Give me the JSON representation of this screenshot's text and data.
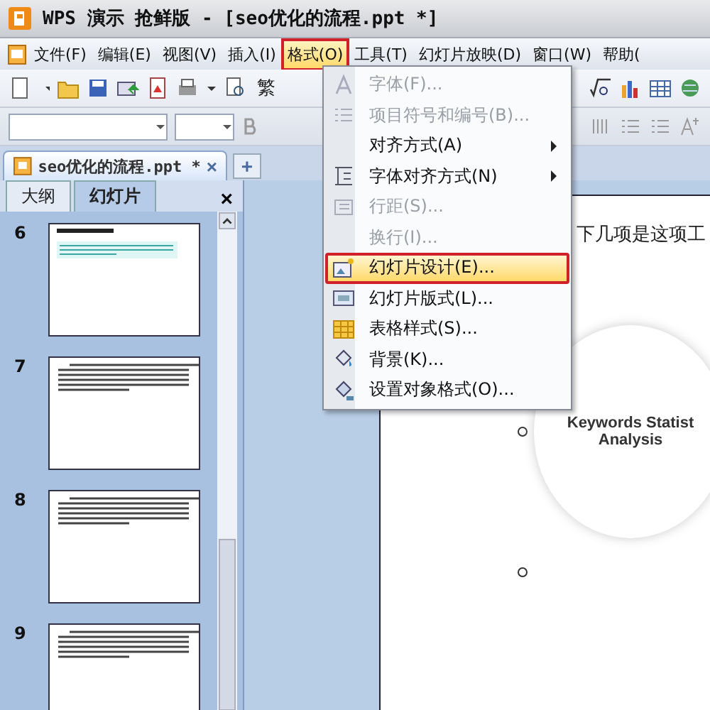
{
  "window": {
    "title": "WPS 演示 抢鲜版 - [seo优化的流程.ppt *]"
  },
  "menu_bar": [
    {
      "label": "文件(F)",
      "selected": false,
      "annotated": false
    },
    {
      "label": "编辑(E)",
      "selected": false,
      "annotated": false
    },
    {
      "label": "视图(V)",
      "selected": false,
      "annotated": false
    },
    {
      "label": "插入(I)",
      "selected": false,
      "annotated": false
    },
    {
      "label": "格式(O)",
      "selected": true,
      "annotated": true
    },
    {
      "label": "工具(T)",
      "selected": false,
      "annotated": false
    },
    {
      "label": "幻灯片放映(D)",
      "selected": false,
      "annotated": false
    },
    {
      "label": "窗口(W)",
      "selected": false,
      "annotated": false
    },
    {
      "label": "帮助(",
      "selected": false,
      "annotated": false
    }
  ],
  "toolbar": {
    "chinese_button": "繁"
  },
  "document_tab": {
    "title": "seo优化的流程.ppt *",
    "close": "×",
    "new_tab": "+"
  },
  "side_panel": {
    "tabs": [
      {
        "label": "大纲",
        "selected": false
      },
      {
        "label": "幻灯片",
        "selected": true
      }
    ],
    "close": "×",
    "slides": [
      {
        "number": "6",
        "kind": "highlight"
      },
      {
        "number": "7",
        "kind": "text"
      },
      {
        "number": "8",
        "kind": "text"
      },
      {
        "number": "9",
        "kind": "text"
      }
    ]
  },
  "slide": {
    "text": "下几项是这项工",
    "circle_title": "Keywords Statist",
    "circle_subtitle": "Analysis"
  },
  "format_menu": [
    {
      "label": "字体(F)...",
      "disabled": true,
      "submenu": false,
      "selected": false,
      "annotated": false
    },
    {
      "label": "项目符号和编号(B)...",
      "disabled": true,
      "submenu": false,
      "selected": false,
      "annotated": false
    },
    {
      "label": "对齐方式(A)",
      "disabled": false,
      "submenu": true,
      "selected": false,
      "annotated": false
    },
    {
      "label": "字体对齐方式(N)",
      "disabled": false,
      "submenu": true,
      "selected": false,
      "annotated": false
    },
    {
      "label": "行距(S)...",
      "disabled": true,
      "submenu": false,
      "selected": false,
      "annotated": false
    },
    {
      "label": "换行(I)...",
      "disabled": true,
      "submenu": false,
      "selected": false,
      "annotated": false
    },
    {
      "label": "幻灯片设计(E)...",
      "disabled": false,
      "submenu": false,
      "selected": true,
      "annotated": true
    },
    {
      "label": "幻灯片版式(L)...",
      "disabled": false,
      "submenu": false,
      "selected": false,
      "annotated": false
    },
    {
      "label": "表格样式(S)...",
      "disabled": false,
      "submenu": false,
      "selected": false,
      "annotated": false
    },
    {
      "label": "背景(K)...",
      "disabled": false,
      "submenu": false,
      "selected": false,
      "annotated": false
    },
    {
      "label": "设置对象格式(O)...",
      "disabled": false,
      "submenu": false,
      "selected": false,
      "annotated": false
    }
  ]
}
